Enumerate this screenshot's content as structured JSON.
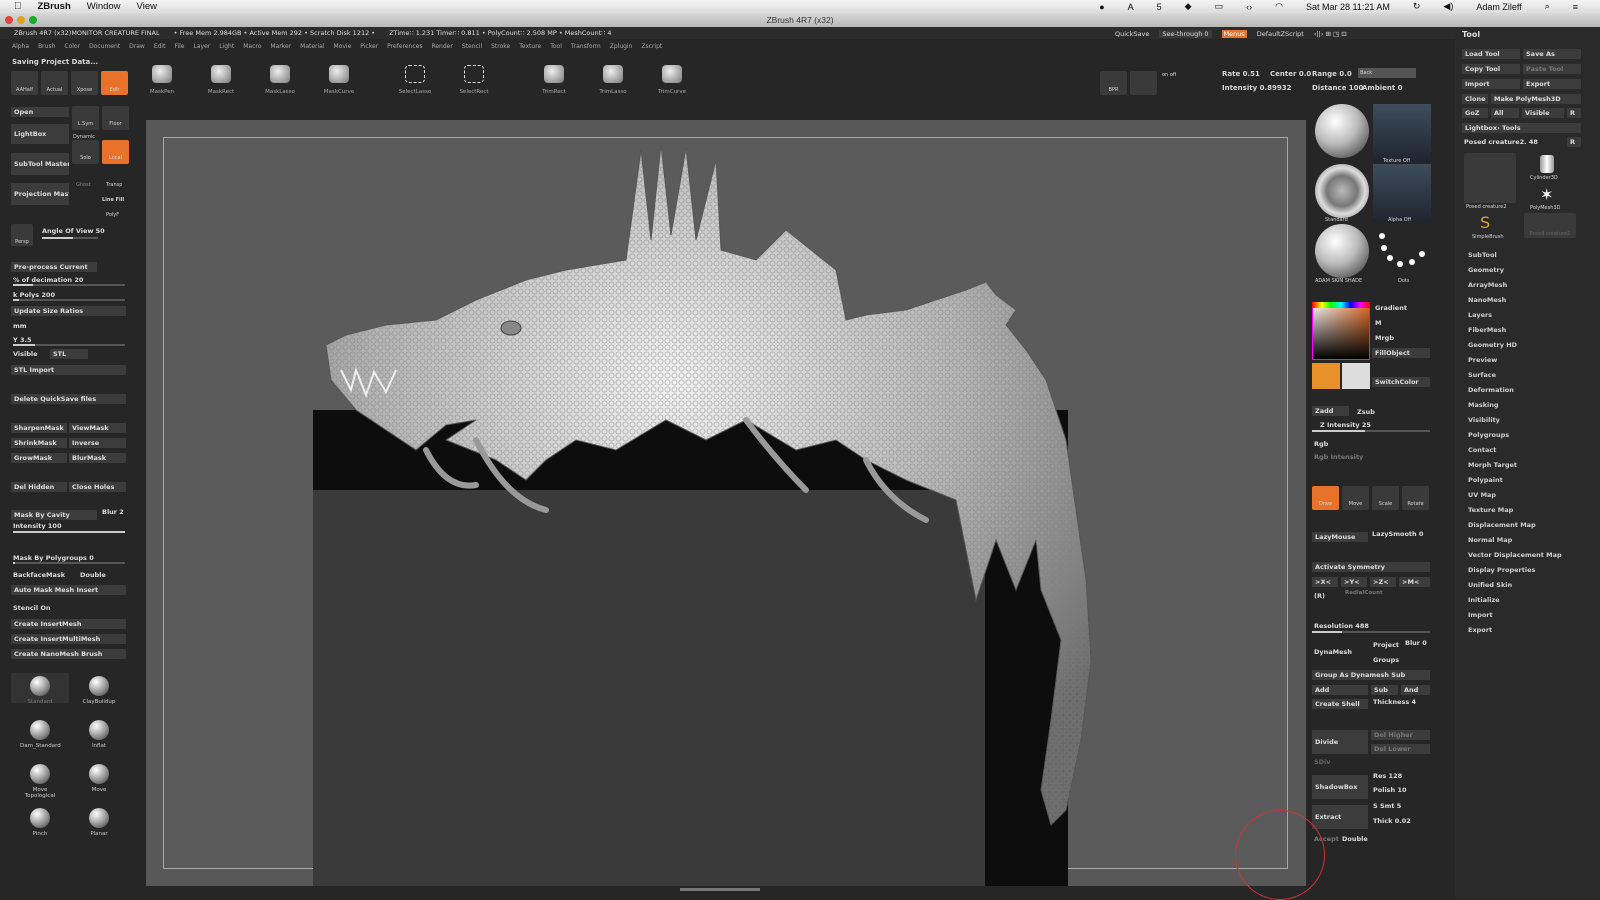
{
  "menubar": {
    "apple": "",
    "app": "ZBrush",
    "items": [
      "Window",
      "View"
    ],
    "clock": "Sat Mar 28  11:21 AM",
    "user": "Adam Zileff",
    "battery": "5"
  },
  "window": {
    "title": "ZBrush 4R7 (x32)"
  },
  "infobar": [
    "ZBrush 4R7 (x32)MONITOR CREATURE FINAL",
    "• Free Mem 2.984GB • Active Mem 292 • Scratch Disk 1212 •",
    "ZTime∷ 1.231 Timer∷ 0.811 • PolyCount∷ 2.508 MP • MeshCount∷ 4"
  ],
  "topright": {
    "quicksave": "QuickSave",
    "seethrough": "See-through  0",
    "menus": "Menus",
    "script": "DefaultZScript"
  },
  "mainmenu": [
    "Alpha",
    "Brush",
    "Color",
    "Document",
    "Draw",
    "Edit",
    "File",
    "Layer",
    "Light",
    "Macro",
    "Marker",
    "Material",
    "Movie",
    "Picker",
    "Preferences",
    "Render",
    "Stencil",
    "Stroke",
    "Texture",
    "Tool",
    "Transform",
    "Zplugin",
    "Zscript"
  ],
  "status": "Saving Project Data...",
  "shelf": [
    "MaskPen",
    "MaskRect",
    "MaskLasso",
    "MaskCurve",
    "SelectLasso",
    "SelectRect",
    "TrimRect",
    "TrimLasso",
    "TrimCurve"
  ],
  "topicons": {
    "aahalf": "AAHalf",
    "actual": "Actual",
    "xpose": "Xpose",
    "edit": "Edit"
  },
  "drawctrl": {
    "bpr": "BPR",
    "onoff": "on  off",
    "rate": "Rate 0.51",
    "center": "Center 0.0",
    "range": "Range 0.0",
    "back": "Back",
    "intensity": "Intensity 0.89932",
    "distance": "Distance 100",
    "ambient": "Ambient 0"
  },
  "left": {
    "open": "Open",
    "lightbox": "LightBox",
    "subtool_master": "SubTool Master",
    "projection_master": "Projection Master",
    "lsym": "L.Sym",
    "floor": "Floor",
    "dynamic": "Dynamic",
    "solo": "Solo",
    "local": "Local",
    "ghost": "Ghost",
    "transp": "Transp",
    "linefill": "Line Fill",
    "polyf": "PolyF",
    "persp": "Persp",
    "angle": "Angle Of View 50",
    "preprocess": "Pre-process Current",
    "decimation": "% of decimation 20",
    "kpolys": "k Polys 200",
    "update": "Update Size Ratios",
    "mm": "mm",
    "y": "Y 3.5",
    "visible": "Visible",
    "stl": "STL",
    "stlimport": "STL Import",
    "delquick": "Delete QuickSave files",
    "sharpen": "SharpenMask",
    "viewmask": "ViewMask",
    "shrink": "ShrinkMask",
    "inverse": "Inverse",
    "grow": "GrowMask",
    "blur": "BlurMask",
    "delhidden": "Del Hidden",
    "closeholes": "Close Holes",
    "cavity": "Mask By Cavity",
    "blurval": "Blur 2",
    "intensity": "Intensity 100",
    "polygroups": "Mask By Polygroups 0",
    "backface": "BackfaceMask",
    "double": "Double",
    "automask": "Auto Mask Mesh Insert",
    "stencil": "Stencil On",
    "insertmesh": "Create InsertMesh",
    "insertmulti": "Create InsertMultiMesh",
    "nanobrush": "Create NanoMesh Brush"
  },
  "brushes": [
    "Standard",
    "ClayBuildup",
    "Dam_Standard",
    "Inflat",
    "Move Topological",
    "Move",
    "Pinch",
    "Planar"
  ],
  "tray": {
    "texture_off": "Texture Off",
    "standard": "Standard",
    "alpha_off": "Alpha Off",
    "adam_shade": "ADAM SKIN SHADE",
    "dots": "Dots",
    "gradient": "Gradient",
    "m": "M",
    "mrgb": "Mrgb",
    "fillobject": "FillObject",
    "switchcolor": "SwitchColor",
    "zadd": "Zadd",
    "zsub": "Zsub",
    "zintensity": "Z Intensity 25",
    "rgb": "Rgb",
    "rgbint": "Rgb Intensity",
    "draw": "Draw",
    "move": "Move",
    "scale": "Scale",
    "rotate": "Rotate",
    "lazymouse": "LazyMouse",
    "lazysmooth": "LazySmooth 0",
    "activate_sym": "Activate Symmetry",
    "symx": ">X<",
    "symy": ">Y<",
    "symz": ">Z<",
    "symm": ">M<",
    "symr": "(R)",
    "radial": "RadialCount",
    "resolution": "Resolution 488",
    "dynamesh": "DynaMesh",
    "project": "Project",
    "blur0": "Blur 0",
    "groups": "Groups",
    "group_as": "Group As Dynamesh Sub",
    "add": "Add",
    "sub": "Sub",
    "and": "And",
    "create_shell": "Create Shell",
    "thickness": "Thickness 4",
    "divide": "Divide",
    "del_higher": "Del Higher",
    "del_lower": "Del Lower",
    "sdiv": "SDiv",
    "shadowbox": "ShadowBox",
    "res128": "Res 128",
    "polish10": "Polish 10",
    "extract": "Extract",
    "ssmt": "S Smt 5",
    "thick": "Thick 0.02",
    "accept": "Accept",
    "double": "Double"
  },
  "toolpanel": {
    "title": "Tool",
    "loadtool": "Load Tool",
    "saveas": "Save As",
    "copytool": "Copy Tool",
    "pastetool": "Paste Tool",
    "import": "Import",
    "export": "Export",
    "clone": "Clone",
    "polymesh": "Make PolyMesh3D",
    "goz": "GoZ",
    "all": "All",
    "visible": "Visible",
    "r": "R",
    "lightbox_tools": "Lightbox› Tools",
    "posed": "Posed creature2. 48",
    "r2": "R",
    "thumbs": [
      "Posed creature2",
      "Cylinder3D",
      "PolyMesh3D",
      "SimpleBrush",
      "Posed creature2"
    ],
    "menu": [
      "SubTool",
      "Geometry",
      "ArrayMesh",
      "NanoMesh",
      "Layers",
      "FiberMesh",
      "Geometry HD",
      "Preview",
      "Surface",
      "Deformation",
      "Masking",
      "Visibility",
      "Polygroups",
      "Contact",
      "Morph Target",
      "Polypaint",
      "UV Map",
      "Texture Map",
      "Displacement Map",
      "Normal Map",
      "Vector Displacement Map",
      "Display Properties",
      "Unified Skin",
      "Initialize",
      "Import",
      "Export"
    ]
  },
  "colors": {
    "accent": "#e8722a"
  }
}
